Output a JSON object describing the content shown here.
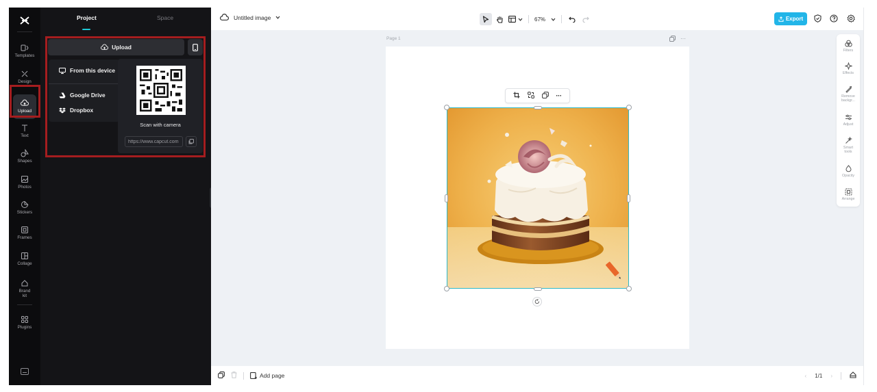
{
  "rail": {
    "items": [
      {
        "label": "Templates",
        "icon": "templates-icon"
      },
      {
        "label": "Design",
        "icon": "design-icon"
      },
      {
        "label": "Upload",
        "icon": "upload-cloud-icon"
      },
      {
        "label": "Text",
        "icon": "text-icon"
      },
      {
        "label": "Shapes",
        "icon": "shapes-icon"
      },
      {
        "label": "Photos",
        "icon": "photos-icon"
      },
      {
        "label": "Stickers",
        "icon": "stickers-icon"
      },
      {
        "label": "Frames",
        "icon": "frames-icon"
      },
      {
        "label": "Collage",
        "icon": "collage-icon"
      },
      {
        "label": "Brand kit",
        "icon": "brand-kit-icon"
      },
      {
        "label": "Plugins",
        "icon": "plugins-icon"
      }
    ],
    "active": "Upload"
  },
  "panel": {
    "tabs": [
      {
        "label": "Project"
      },
      {
        "label": "Space"
      }
    ],
    "active_tab": "Project",
    "upload_label": "Upload",
    "sources": [
      {
        "label": "From this device",
        "icon": "monitor-icon"
      },
      {
        "label": "Google Drive",
        "icon": "google-drive-icon"
      },
      {
        "label": "Dropbox",
        "icon": "dropbox-icon"
      }
    ],
    "scan_label": "Scan with camera",
    "url_value": "https://www.capcut.com"
  },
  "topbar": {
    "title": "Untitled image",
    "zoom": "67%",
    "export_label": "Export"
  },
  "canvas": {
    "page_label": "Page 1"
  },
  "right_tools": [
    {
      "label": "Filters",
      "icon": "filters-icon"
    },
    {
      "label": "Effects",
      "icon": "effects-icon"
    },
    {
      "label": "Remove backgr...",
      "icon": "remove-background-icon"
    },
    {
      "label": "Adjust",
      "icon": "adjust-icon"
    },
    {
      "label": "Smart tools",
      "icon": "smart-tools-icon"
    },
    {
      "label": "Opacity",
      "icon": "opacity-icon"
    },
    {
      "label": "Arrange",
      "icon": "arrange-icon"
    }
  ],
  "bottombar": {
    "add_page_label": "Add page",
    "page_counter": "1/1"
  },
  "colors": {
    "accent": "#1ec8d6",
    "export": "#22b5e8",
    "highlight": "#a51d1f",
    "dark_bg": "#0c0c0e"
  }
}
